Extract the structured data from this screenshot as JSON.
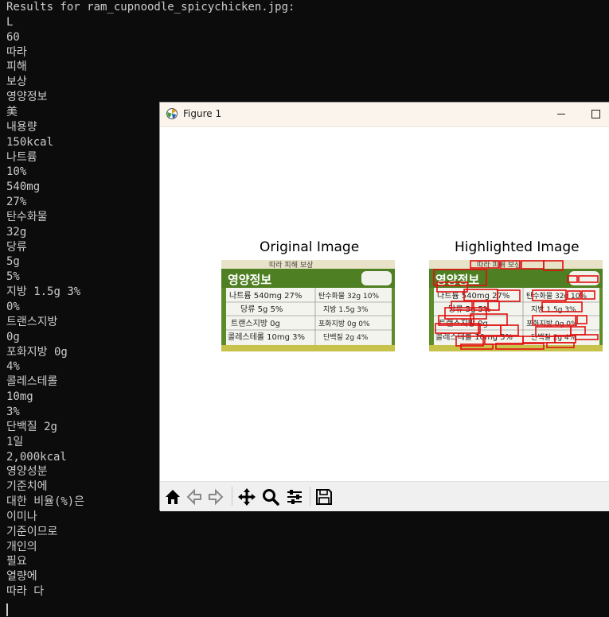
{
  "terminal": {
    "lines": [
      "Results for ram_cupnoodle_spicychicken.jpg:",
      "L",
      "60",
      "따라",
      "피해",
      "보상",
      "영양정보",
      "美",
      "내용량",
      "150kcal",
      "나트륨",
      "10%",
      "540mg",
      "27%",
      "탄수화물",
      "32g",
      "당류",
      "5g",
      "5%",
      "지방 1.5g 3%",
      "0%",
      "트랜스지방",
      "0g",
      "포화지방 0g",
      "4%",
      "콜레스테롤",
      "10mg",
      "3%",
      "단백질 2g",
      "1일",
      "2,000kcal",
      "영양성분",
      "기준치에",
      "대한 비율(%)은",
      "이미나",
      "기준이므로",
      "개인의",
      "필요",
      "열량에",
      "따라 다"
    ]
  },
  "figure": {
    "window_title": "Figure 1",
    "icons": {
      "app": "matplotlib-icon",
      "minimize": "minimize-icon",
      "maximize": "maximize-icon"
    },
    "subplots": [
      {
        "title": "Original Image"
      },
      {
        "title": "Highlighted Image"
      }
    ],
    "label_text": {
      "banner": "따라 피해 보상",
      "heading": "영양정보",
      "row1_left": "나트륨 540mg 27%",
      "row1_right": "탄수화물 32g 10%",
      "row2_left": "당류 5g 5%",
      "row2_right": "지방 1.5g 3%",
      "row3_left": "트랜스지방 0g",
      "row3_right": "포화지방 0g 0%",
      "row4_left": "콜레스테롤 10mg 3%",
      "row4_right": "단백질 2g 4%"
    },
    "toolbar": {
      "tools": [
        "home-icon",
        "back-arrow-icon",
        "forward-arrow-icon",
        "pan-icon",
        "zoom-icon",
        "configure-subplots-icon",
        "save-icon"
      ]
    }
  },
  "colors": {
    "terminal_bg": "#0c0c0c",
    "terminal_fg": "#cccccc",
    "label_green": "#5d8b2a",
    "highlight_box": "#e01010"
  }
}
